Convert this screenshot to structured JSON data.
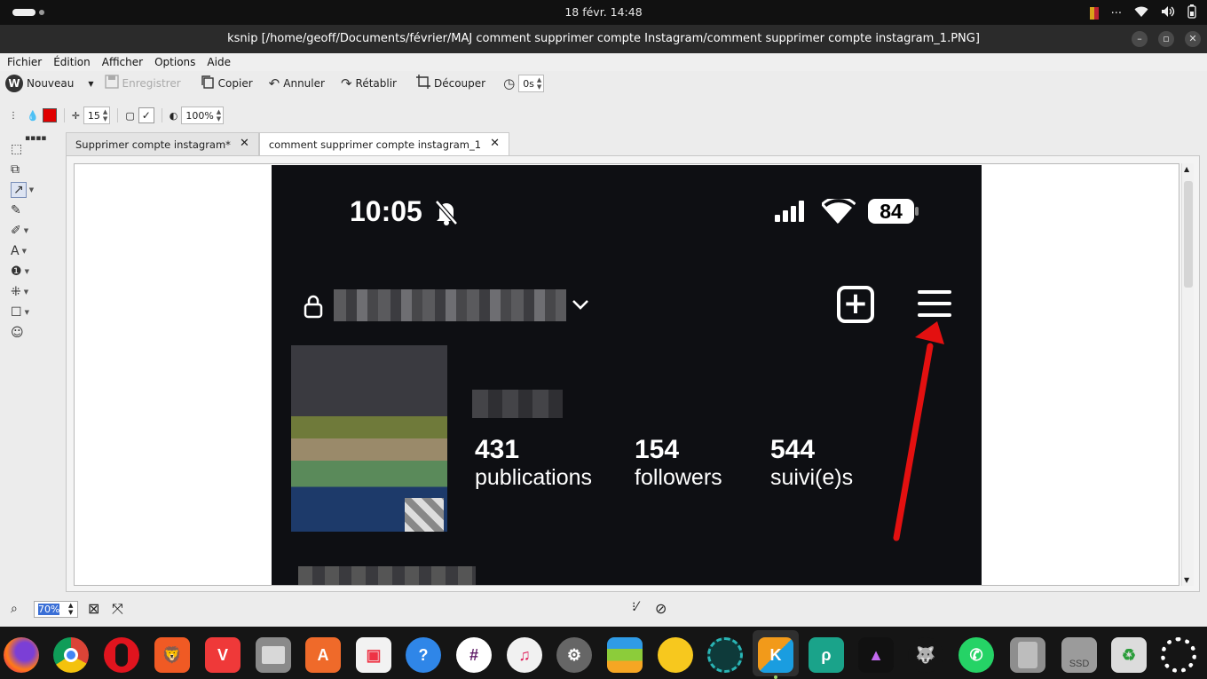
{
  "system_bar": {
    "datetime": "18 févr.  14:48"
  },
  "window": {
    "title": "ksnip [/home/geoff/Documents/février/MAJ comment supprimer compte Instagram/comment supprimer compte instagram_1.PNG]"
  },
  "menu": [
    "Fichier",
    "Édition",
    "Afficher",
    "Options",
    "Aide"
  ],
  "toolbar": {
    "new_label": "Nouveau",
    "save_label": "Enregistrer",
    "copy_label": "Copier",
    "undo_label": "Annuler",
    "redo_label": "Rétablir",
    "crop_label": "Découper",
    "delay_value": "0s"
  },
  "settings": {
    "color": "#e00000",
    "width_value": "15",
    "opacity_value": "100%"
  },
  "tabs": [
    {
      "label": "Supprimer compte instagram*",
      "active": false
    },
    {
      "label": "comment supprimer compte instagram_1",
      "active": true
    }
  ],
  "screenshot": {
    "time": "10:05",
    "battery": "84",
    "stats": [
      {
        "number": "431",
        "label": "publications"
      },
      {
        "number": "154",
        "label": "followers"
      },
      {
        "number": "544",
        "label": "suivi(e)s"
      }
    ],
    "arrow_color": "#e31010"
  },
  "status": {
    "zoom_value": "70%"
  },
  "taskbar": {
    "apps": [
      "firefox-icon",
      "chrome-icon",
      "opera-icon",
      "brave-icon",
      "vivaldi-icon",
      "files-icon",
      "appstore-icon",
      "bag-store-icon",
      "help-icon",
      "slack-icon",
      "music-icon",
      "settings-icon",
      "layers-icon",
      "yellow-app-icon",
      "spot-icon",
      "ksnip-icon",
      "photopea-icon",
      "affinity-icon",
      "gimp-icon",
      "whatsapp-icon",
      "drive-icon",
      "ssd-icon",
      "trash-icon",
      "circle-app-icon"
    ],
    "ssd_label": "SSD"
  }
}
